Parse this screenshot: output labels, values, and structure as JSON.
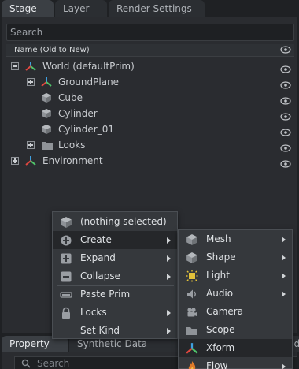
{
  "tabs": [
    "Stage",
    "Layer",
    "Render Settings"
  ],
  "search": {
    "placeholder": "Search"
  },
  "column_header": "Name (Old to New)",
  "tree": [
    {
      "label": "World (defaultPrim)",
      "expander": "minus",
      "icon": "xform-icon"
    },
    {
      "label": "GroundPlane",
      "expander": "plus",
      "icon": "xform-icon"
    },
    {
      "label": "Cube",
      "expander": "",
      "icon": "cube-icon"
    },
    {
      "label": "Cylinder",
      "expander": "",
      "icon": "cube-icon"
    },
    {
      "label": "Cylinder_01",
      "expander": "",
      "icon": "cube-icon"
    },
    {
      "label": "Looks",
      "expander": "plus",
      "icon": "folder-icon"
    },
    {
      "label": "Environment",
      "expander": "plus",
      "icon": "xform-icon"
    }
  ],
  "context_menu": {
    "items": [
      {
        "label": "(nothing selected)",
        "icon": "cube-icon",
        "submenu": false
      },
      {
        "label": "Create",
        "icon": "add-circle-icon",
        "submenu": true
      },
      {
        "label": "Expand",
        "icon": "expand-icon",
        "submenu": true
      },
      {
        "label": "Collapse",
        "icon": "collapse-icon",
        "submenu": true
      },
      {
        "label": "Paste Prim",
        "icon": "paste-icon",
        "submenu": false
      },
      {
        "label": "Locks",
        "icon": "lock-icon",
        "submenu": true
      },
      {
        "label": "Set Kind",
        "icon": "",
        "submenu": true
      }
    ]
  },
  "create_submenu": {
    "items": [
      {
        "label": "Mesh",
        "icon": "cube-icon",
        "submenu": true
      },
      {
        "label": "Shape",
        "icon": "cube-icon",
        "submenu": true
      },
      {
        "label": "Light",
        "icon": "light-icon",
        "submenu": true
      },
      {
        "label": "Audio",
        "icon": "audio-icon",
        "submenu": true
      },
      {
        "label": "Camera",
        "icon": "camera-icon",
        "submenu": false
      },
      {
        "label": "Scope",
        "icon": "folder-icon",
        "submenu": false
      },
      {
        "label": "Xform",
        "icon": "xform-icon",
        "submenu": false
      },
      {
        "label": "Flow",
        "icon": "flame-icon",
        "submenu": true
      }
    ]
  },
  "bottom_tabs": [
    "Property",
    "Synthetic Data Recorder",
    "Ed"
  ],
  "bottom_search": {
    "placeholder": "Search"
  }
}
